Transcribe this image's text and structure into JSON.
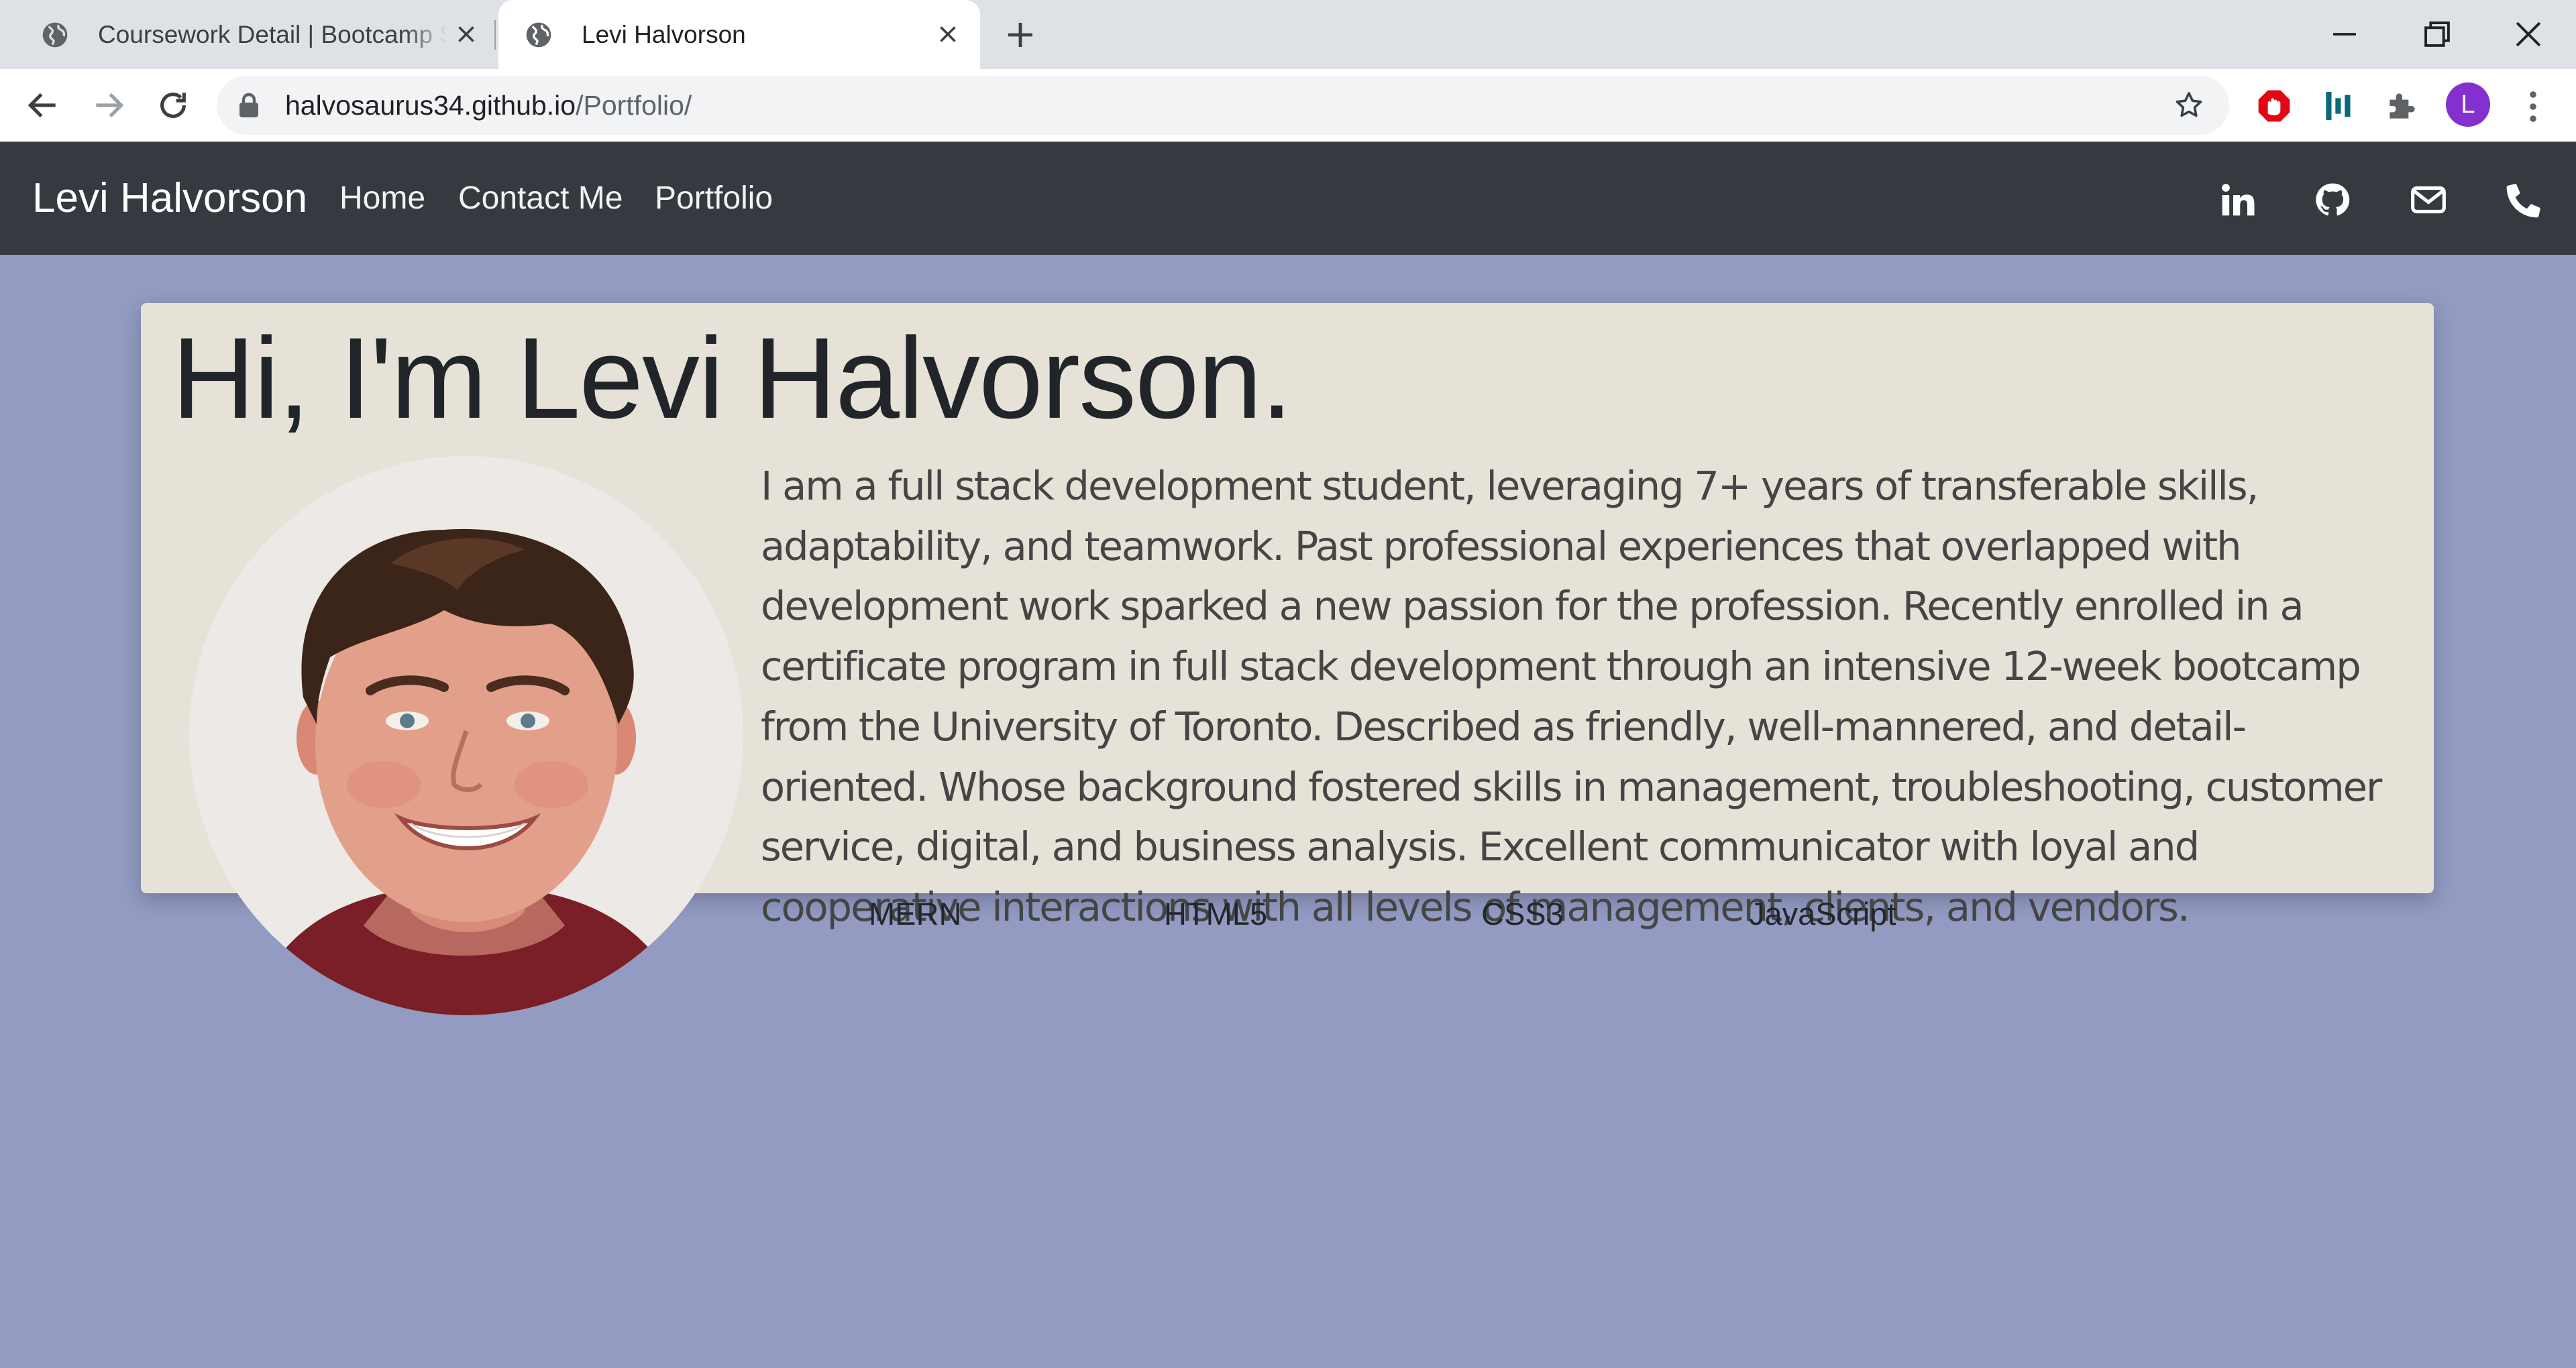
{
  "browser": {
    "tabs": [
      {
        "title": "Coursework Detail | Bootcamp Spot",
        "active": false,
        "icon": "globe-icon"
      },
      {
        "title": "Levi Halvorson",
        "active": true,
        "icon": "globe-icon"
      }
    ],
    "address": {
      "host": "halvosaurus34.github.io",
      "path": "/Portfolio/"
    },
    "profile_initial": "L",
    "profile_color": "#8430ce"
  },
  "site": {
    "brand": "Levi Halvorson",
    "nav_links": [
      "Home",
      "Contact Me",
      "Portfolio"
    ],
    "social_icons": [
      "linkedin-icon",
      "github-icon",
      "mail-icon",
      "phone-icon"
    ],
    "navbar_color": "#343a40",
    "background_color": "#939bc3"
  },
  "hero": {
    "title": "Hi, I'm Levi Halvorson.",
    "bio": "I am a full stack development student, leveraging 7+ years of transferable skills, adaptability, and teamwork. Past professional experiences that overlapped with development work sparked a new passion for the profession. Recently enrolled in a certificate program in full stack development through an intensive 12-week bootcamp from the University of Toronto. Described as friendly, well-mannered, and detail-oriented. Whose background fostered skills in management, troubleshooting, customer service, digital, and business analysis. Excellent communicator with loyal and cooperative interactions with all levels of management, clients, and vendors.",
    "card_color": "#e6e2d8"
  },
  "skills": [
    "MERN",
    "HTML5",
    "CSS3",
    "JavaScript"
  ]
}
